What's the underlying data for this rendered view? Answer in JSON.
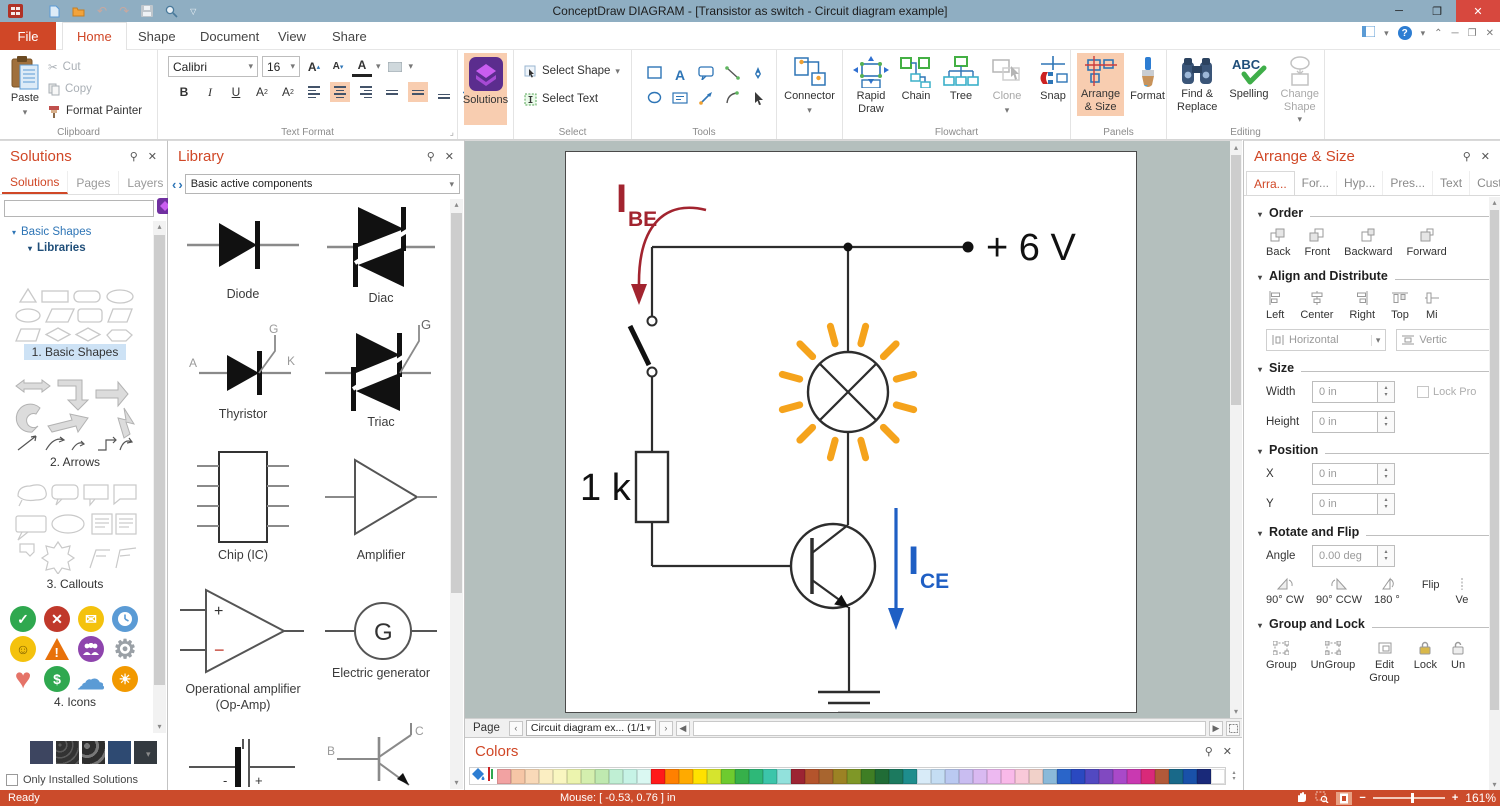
{
  "window": {
    "title": "ConceptDraw DIAGRAM - [Transistor as switch - Circuit diagram example]"
  },
  "tabs": {
    "file": "File",
    "home": "Home",
    "shape": "Shape",
    "document": "Document",
    "view": "View",
    "share": "Share"
  },
  "ribbon": {
    "paste": "Paste",
    "cut": "Cut",
    "copy": "Copy",
    "format_painter": "Format Painter",
    "clipboard_group": "Clipboard",
    "font_name": "Calibri",
    "font_size": "16",
    "text_format_group": "Text Format",
    "solutions": "Solutions",
    "select_shape": "Select Shape",
    "select_text": "Select Text",
    "select_group": "Select",
    "tools_group": "Tools",
    "connector": "Connector",
    "rapid_draw": "Rapid\nDraw",
    "chain": "Chain",
    "tree": "Tree",
    "clone": "Clone",
    "snap": "Snap",
    "flowchart_group": "Flowchart",
    "arrange_size": "Arrange\n& Size",
    "format": "Format",
    "panels_group": "Panels",
    "find_replace": "Find &\nReplace",
    "spelling": "Spelling",
    "change_shape": "Change\nShape",
    "editing_group": "Editing"
  },
  "solutions_panel": {
    "title": "Solutions",
    "tabs": [
      "Solutions",
      "Pages",
      "Layers"
    ],
    "tree_basic_shapes": "Basic Shapes",
    "tree_libraries": "Libraries",
    "items": [
      "1. Basic Shapes",
      "2. Arrows",
      "3. Callouts",
      "4. Icons"
    ],
    "only_installed": "Only Installed Solutions"
  },
  "library_panel": {
    "title": "Library",
    "selector": "Basic active components",
    "shapes": [
      "Diode",
      "Diac",
      "Thyristor",
      "Triac",
      "Chip (IC)",
      "Amplifier",
      "Operational amplifier (Op-Amp)",
      "Electric generator"
    ],
    "letters": {
      "a": "A",
      "k": "K",
      "g": "G",
      "gen": "G",
      "minus": "-",
      "plus": "+",
      "b": "B",
      "c": "C"
    }
  },
  "circuit": {
    "ibe": "I",
    "ibe_sub": "BE",
    "supply": "+ 6 V",
    "resistor": "1 k",
    "ice": "I",
    "ice_sub": "CE"
  },
  "page_bar": {
    "label": "Page",
    "selector": "Circuit diagram ex... (1/1"
  },
  "colors_panel": {
    "title": "Colors",
    "swatches": [
      "#f2a2a2",
      "#f6c6a6",
      "#f9d9b8",
      "#fbeec2",
      "#f9f6c0",
      "#ecf4ae",
      "#d4efae",
      "#bfe9b0",
      "#c0efd4",
      "#c6f3e6",
      "#daf8f2",
      "#ff1a1a",
      "#ff8000",
      "#ffaa00",
      "#ffe100",
      "#d6e42e",
      "#6ecb2f",
      "#36b04a",
      "#2eb878",
      "#3cc5aa",
      "#92e1dc",
      "#9c2433",
      "#b4542c",
      "#a8652f",
      "#9c8224",
      "#7f9727",
      "#3f7e24",
      "#206c36",
      "#1c7a5f",
      "#1e8d8d",
      "#d8ebf8",
      "#c4ddf3",
      "#bac9f1",
      "#c9bdf1",
      "#d9b9f1",
      "#edb9f1",
      "#f9b9e9",
      "#f9c9d9",
      "#f1d1c9",
      "#8ab9d9",
      "#2a65c9",
      "#2a49c1",
      "#5249c1",
      "#8149c1",
      "#a949c9",
      "#c939b1",
      "#d92979",
      "#b15939",
      "#196989",
      "#1951a9",
      "#192979",
      "#ffffff"
    ]
  },
  "arrange_panel": {
    "title": "Arrange & Size",
    "tabs": [
      "Arra...",
      "For...",
      "Hyp...",
      "Pres...",
      "Text",
      "Cust..."
    ],
    "order": {
      "label": "Order",
      "items": [
        "Back",
        "Front",
        "Backward",
        "Forward"
      ]
    },
    "align": {
      "label": "Align and Distribute",
      "items": [
        "Left",
        "Center",
        "Right",
        "Top",
        "Mi"
      ],
      "horizontal": "Horizontal",
      "vertical": "Vertic"
    },
    "size": {
      "label": "Size",
      "width": "Width",
      "height": "Height",
      "width_value": "0 in",
      "height_value": "0 in",
      "lock": "Lock Pro"
    },
    "position": {
      "label": "Position",
      "x": "X",
      "y": "Y",
      "x_value": "0 in",
      "y_value": "0 in"
    },
    "rotate": {
      "label": "Rotate and Flip",
      "angle": "Angle",
      "angle_value": "0.00 deg",
      "cw": "90° CW",
      "ccw": "90° CCW",
      "d180": "180 °",
      "flip": "Flip",
      "ve": "Ve"
    },
    "group": {
      "label": "Group and Lock",
      "items": [
        "Group",
        "UnGroup",
        "Edit\nGroup",
        "Lock",
        "Un"
      ]
    }
  },
  "status_bar": {
    "ready": "Ready",
    "mouse": "Mouse: [ -0.53, 0.76 ] in",
    "zoom_level": "161%"
  }
}
